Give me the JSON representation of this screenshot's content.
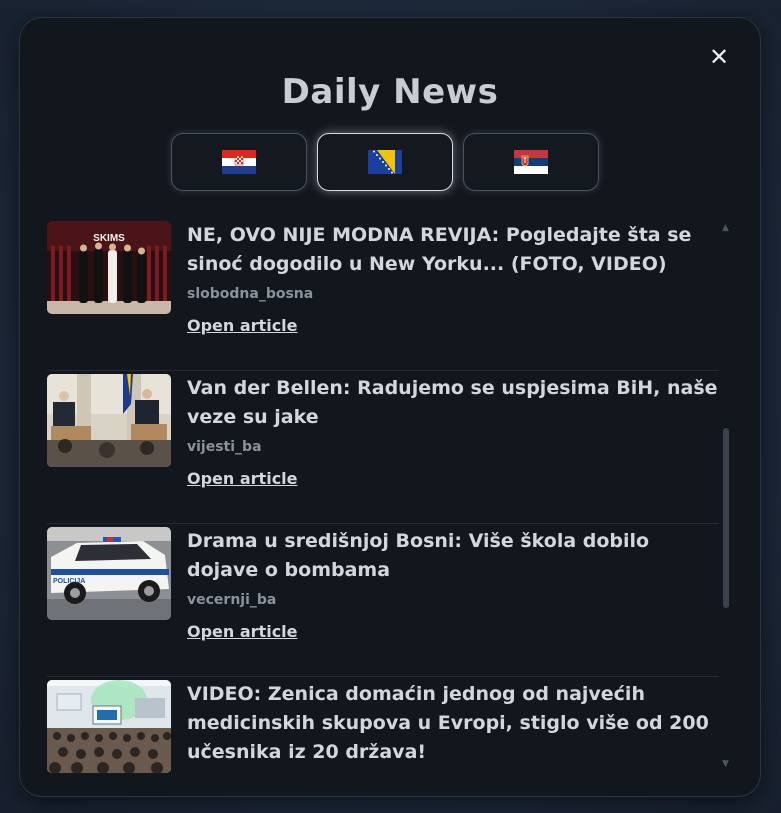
{
  "header": {
    "title": "Daily News",
    "close_icon": "close-icon"
  },
  "flags": [
    {
      "country": "Croatia",
      "icon": "croatia-flag-icon",
      "selected": false
    },
    {
      "country": "Bosnia and Herzegovina",
      "icon": "bosnia-flag-icon",
      "selected": true
    },
    {
      "country": "Serbia",
      "icon": "serbia-flag-icon",
      "selected": false
    }
  ],
  "articles": [
    {
      "headline": "NE, OVO NIJE MODNA REVIJA: Pogledajte šta se sinoć dogodilo u New Yorku... (FOTO, VIDEO)",
      "source": "slobodna_bosna",
      "link_label": "Open article",
      "thumbnail": "red-carpet-photo"
    },
    {
      "headline": "Van der Bellen: Radujemo se uspjesima BiH, naše veze su jake",
      "source": "vijesti_ba",
      "link_label": "Open article",
      "thumbnail": "press-conference-photo"
    },
    {
      "headline": "Drama u središnjoj Bosni: Više škola dobilo dojave o bombama",
      "source": "vecernji_ba",
      "link_label": "Open article",
      "thumbnail": "police-car-photo"
    },
    {
      "headline": "VIDEO: Zenica domaćin jednog od najvećih medicinskih skupova u Evropi, stiglo više od 200 učesnika iz 20 država!",
      "source": "",
      "link_label": "",
      "thumbnail": "conference-hall-photo"
    }
  ],
  "colors": {
    "panel_bg": "#12161d",
    "title_text": "#c9cdd3",
    "headline_text": "#d3d6db",
    "source_text": "#8c929b"
  }
}
